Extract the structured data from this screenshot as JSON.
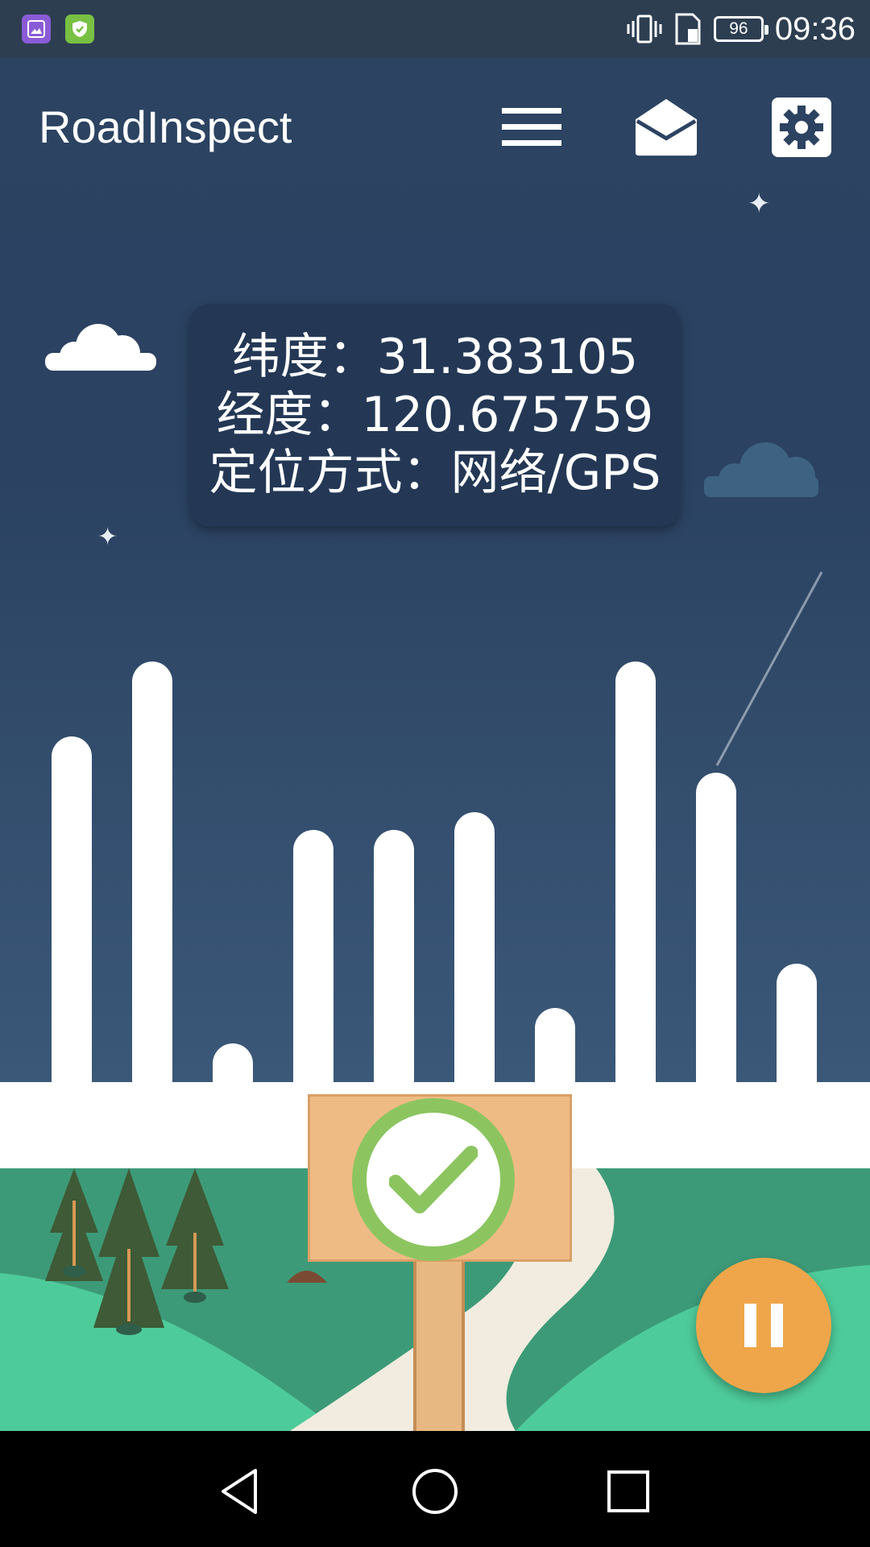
{
  "status_bar": {
    "time": "09:36",
    "battery": "96",
    "icons": [
      "gallery-app-icon",
      "shield-app-icon",
      "vibrate-icon",
      "sim-icon",
      "battery-icon"
    ]
  },
  "toolbar": {
    "title": "RoadInspect",
    "actions": [
      "menu-icon",
      "mail-icon",
      "settings-icon"
    ]
  },
  "location": {
    "latitude_line": "纬度：31.383105",
    "longitude_line": "经度：120.675759",
    "method_line": "定位方式：网络/GPS"
  },
  "equalizer": {
    "levels": [
      0.78,
      0.95,
      0.09,
      0.57,
      0.57,
      0.61,
      0.17,
      0.95,
      0.7,
      0.27
    ]
  },
  "status_sign": {
    "icon": "check-icon"
  },
  "fab": {
    "icon": "pause-icon"
  },
  "nav": {
    "icons": [
      "back-icon",
      "home-icon",
      "recents-icon"
    ]
  },
  "colors": {
    "sky": "#2c4361",
    "card": "#233753",
    "fab": "#efa64a",
    "check": "#8cc560",
    "grass": "#3d9a78",
    "hill": "#4ecb9a"
  }
}
